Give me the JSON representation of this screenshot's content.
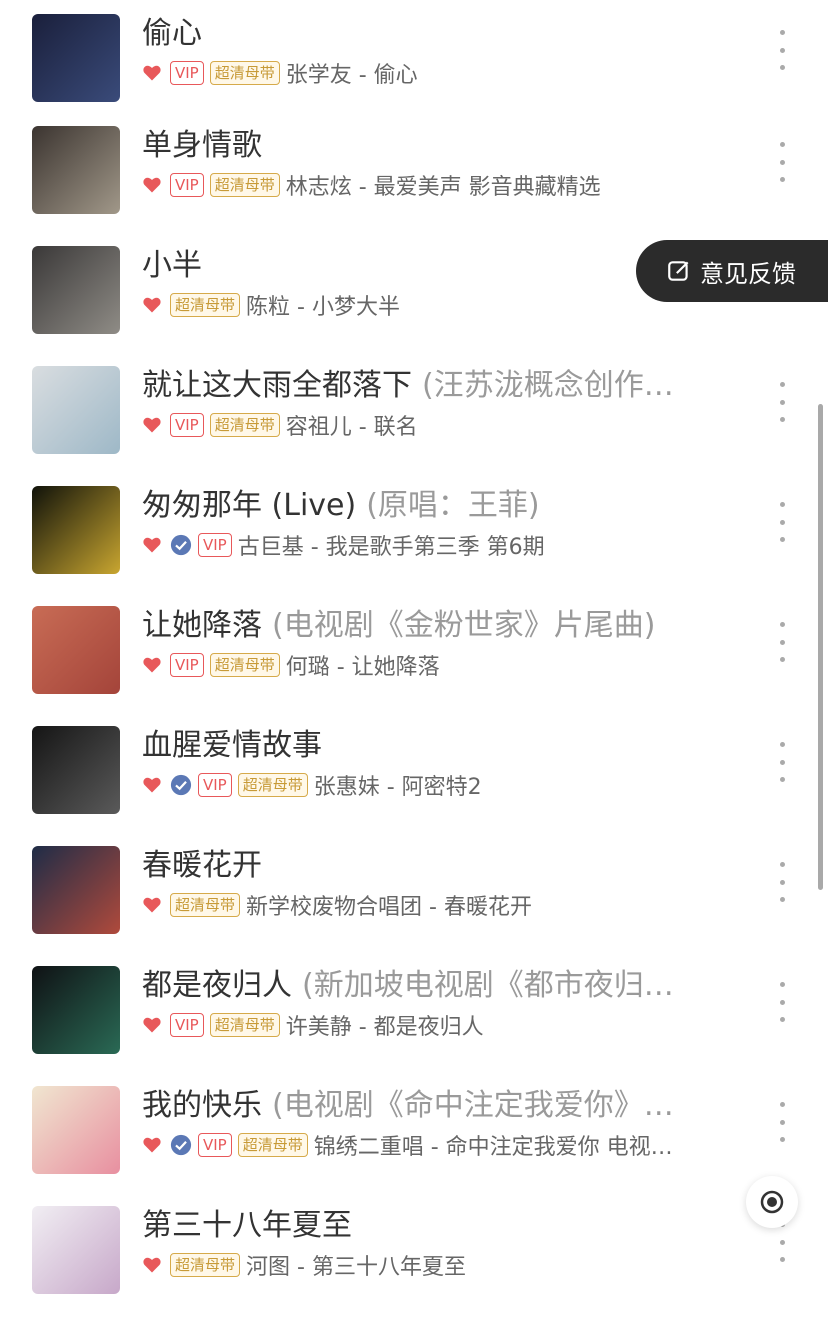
{
  "songs": [
    {
      "title": "偷心",
      "subtitle": "",
      "liked": true,
      "verified": false,
      "vip": true,
      "hq": true,
      "meta": "张学友 - 偷心",
      "cover_colors": [
        "#1a1f3b",
        "#3a4b7a"
      ]
    },
    {
      "title": "单身情歌",
      "subtitle": "",
      "liked": true,
      "verified": false,
      "vip": true,
      "hq": true,
      "meta": "林志炫 - 最爱美声 影音典藏精选",
      "cover_colors": [
        "#3b3430",
        "#a19889"
      ]
    },
    {
      "title": "小半",
      "subtitle": "",
      "liked": true,
      "verified": false,
      "vip": false,
      "hq": true,
      "meta": "陈粒 - 小梦大半",
      "cover_colors": [
        "#3a3838",
        "#8f8c86"
      ]
    },
    {
      "title": "就让这大雨全都落下",
      "subtitle": "(汪苏泷概念创作…",
      "liked": true,
      "verified": false,
      "vip": true,
      "hq": true,
      "meta": "容祖儿 - 联名",
      "cover_colors": [
        "#d9dde0",
        "#9eb8c7"
      ]
    },
    {
      "title": "匆匆那年 (Live)",
      "subtitle": "(原唱：王菲)",
      "liked": true,
      "verified": true,
      "vip": true,
      "hq": false,
      "meta": "古巨基 - 我是歌手第三季 第6期",
      "cover_colors": [
        "#10120a",
        "#c9a630"
      ]
    },
    {
      "title": "让她降落",
      "subtitle": "(电视剧《金粉世家》片尾曲)",
      "liked": true,
      "verified": false,
      "vip": true,
      "hq": true,
      "meta": "何璐 - 让她降落",
      "cover_colors": [
        "#c86c55",
        "#a4443a"
      ]
    },
    {
      "title": "血腥爱情故事",
      "subtitle": "",
      "liked": true,
      "verified": true,
      "vip": true,
      "hq": true,
      "meta": "张惠妹 - 阿密特2",
      "cover_colors": [
        "#151515",
        "#5a5a5a"
      ]
    },
    {
      "title": "春暖花开",
      "subtitle": "",
      "liked": true,
      "verified": false,
      "vip": false,
      "hq": true,
      "meta": "新学校废物合唱团 - 春暖花开",
      "cover_colors": [
        "#1e2c47",
        "#b04a3c"
      ]
    },
    {
      "title": "都是夜归人",
      "subtitle": "(新加坡电视剧《都市夜归…",
      "liked": true,
      "verified": false,
      "vip": true,
      "hq": true,
      "meta": "许美静 - 都是夜归人",
      "cover_colors": [
        "#0f1114",
        "#2a6a55"
      ]
    },
    {
      "title": "我的快乐",
      "subtitle": "(电视剧《命中注定我爱你》…",
      "liked": true,
      "verified": true,
      "vip": true,
      "hq": true,
      "meta": "锦绣二重唱 - 命中注定我爱你 电视…",
      "cover_colors": [
        "#f0e6d0",
        "#e88fa0"
      ]
    },
    {
      "title": "第三十八年夏至",
      "subtitle": "",
      "liked": true,
      "verified": false,
      "vip": false,
      "hq": true,
      "meta": "河图 - 第三十八年夏至",
      "cover_colors": [
        "#f1eef3",
        "#c7a8c9"
      ]
    }
  ],
  "tags": {
    "vip": "VIP",
    "hq": "超清母带"
  },
  "feedback_label": "意见反馈",
  "accent_red": "#e8585a",
  "accent_gold": "#c79a37"
}
